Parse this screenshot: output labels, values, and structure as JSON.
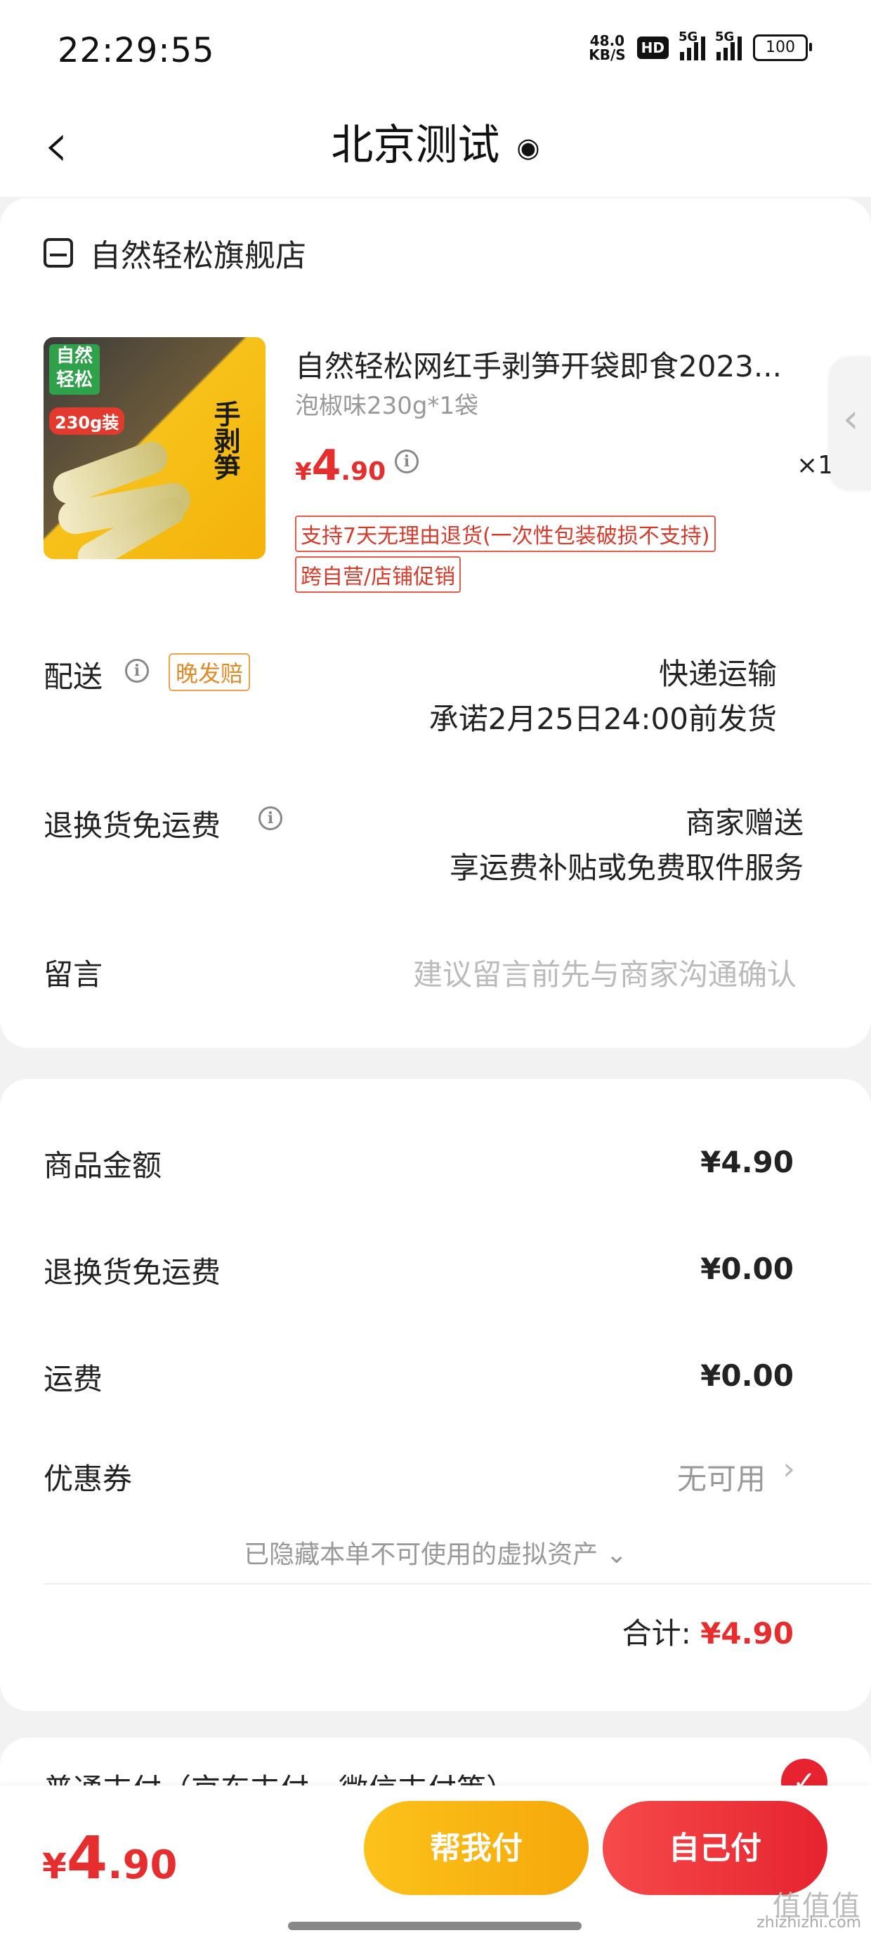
{
  "status_bar": {
    "time": "22:29:55",
    "net_speed_value": "48.0",
    "net_speed_unit": "KB/S",
    "hd": "HD",
    "sim1": "5G",
    "sim2": "5G",
    "battery": "100"
  },
  "nav": {
    "title": "北京测试",
    "back_icon": "chevron-left-icon",
    "location_icon": "location-pin-icon"
  },
  "store": {
    "name": "自然轻松旗舰店",
    "icon": "store-icon"
  },
  "product": {
    "title": "自然轻松网红手剥笋开袋即食2023...",
    "spec": "泡椒味230g*1袋",
    "price_symbol": "¥",
    "price_int": "4",
    "price_dec": ".90",
    "quantity": "×1",
    "tag1": "支持7天无理由退货(一次性包装破损不支持)",
    "tag2": "跨自营/店铺促销",
    "image": {
      "brand_badge": "自然轻松",
      "weight_badge": "230g装",
      "pack_text": "手剥笋"
    }
  },
  "delivery": {
    "label": "配送",
    "late_badge": "晚发赔",
    "method": "快递运输",
    "promise": "承诺2月25日24:00前发货"
  },
  "return_shipping": {
    "label": "退换货免运费",
    "value_line1": "商家赠送",
    "value_line2": "享运费补贴或免费取件服务"
  },
  "message": {
    "label": "留言",
    "placeholder": "建议留言前先与商家沟通确认"
  },
  "fees": {
    "goods_label": "商品金额",
    "goods_value": "¥4.90",
    "return_label": "退换货免运费",
    "return_value": "¥0.00",
    "shipping_label": "运费",
    "shipping_value": "¥0.00",
    "coupon_label": "优惠券",
    "coupon_value": "无可用",
    "hidden_assets": "已隐藏本单不可使用的虚拟资产",
    "total_label": "合计:",
    "total_value": "¥4.90"
  },
  "payment": {
    "type": "普通支付（京东支付、微信支付等）"
  },
  "bottom": {
    "price_symbol": "¥",
    "price_int": "4",
    "price_dec": ".90",
    "help_pay": "帮我付",
    "self_pay": "自己付"
  },
  "watermark": {
    "main": "值值值",
    "site": "zhizhizhi.com"
  },
  "colors": {
    "price_red": "#e62e2e",
    "help_button": "#f5a80a",
    "self_button": "#e6232f"
  }
}
